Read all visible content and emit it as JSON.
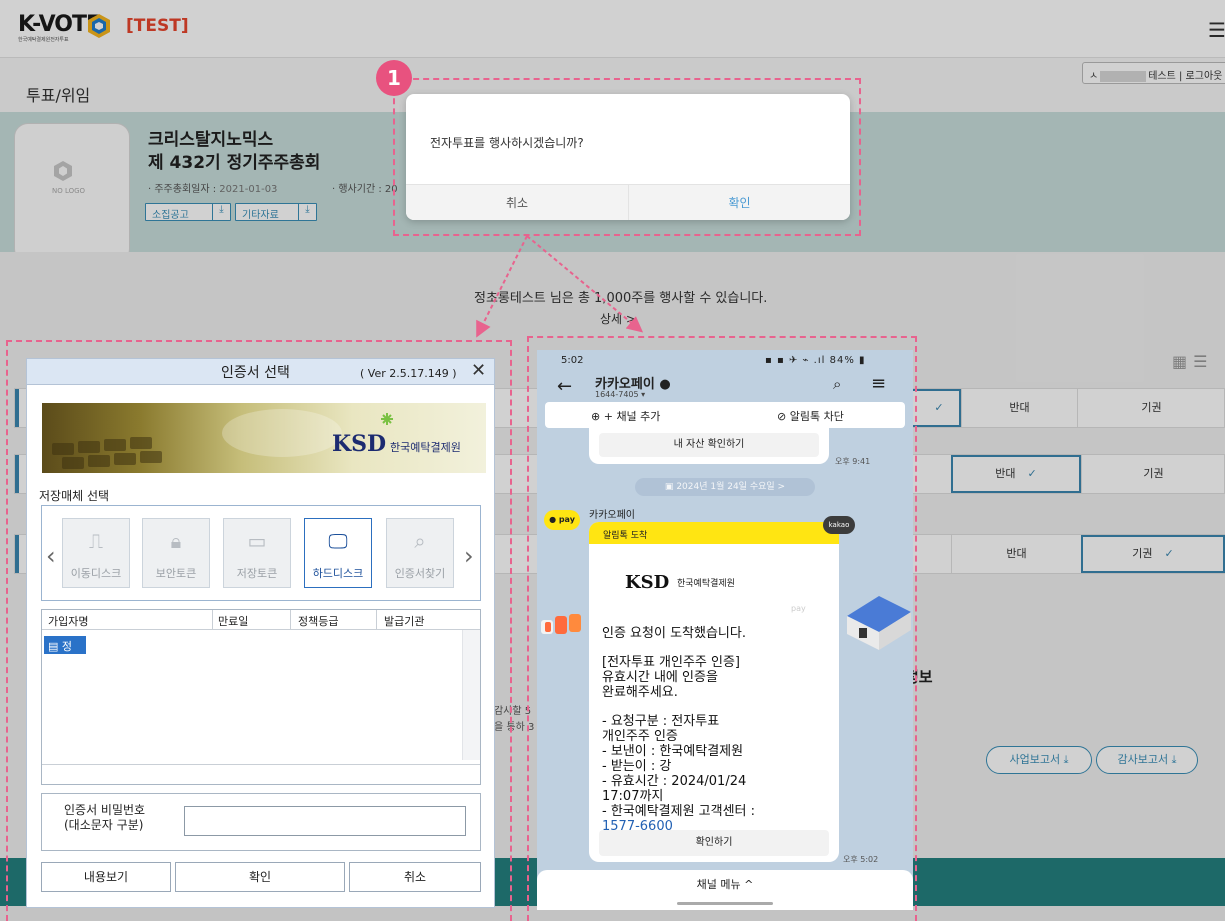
{
  "app": {
    "logo": "K-VOTE",
    "logo_sub": "한국예탁결제원전자투표",
    "test_tag": "[TEST]",
    "page_title": "투표/위임",
    "user_suffix": "테스트",
    "logout": "로그아웃"
  },
  "meeting": {
    "nologo": "NO LOGO",
    "company": "크리스탈지노믹스",
    "name": "제 432기 정기주주총회",
    "date_label": "· 주주총회일자 :",
    "date_value": "2021-01-03",
    "period_label": "· 행사기간 : 20",
    "notice_btn": "소집공고",
    "etc_btn": "기타자료"
  },
  "body": {
    "shares_text": "정초롱테스트 님은 총 1,000주를 행사할 수 있습니다.",
    "detail": "상세 >",
    "oppose": "반대",
    "abstain": "기권",
    "check": "✓",
    "info_heading": "정보",
    "frag1": "감사할 5",
    "frag2": "을 통하 3",
    "biz_report": "사업보고서 ⤓",
    "audit_report": "감사보고서 ⤓"
  },
  "confirm_dialog": {
    "step": "1",
    "message": "전자투표를 행사하시겠습니까?",
    "cancel": "취소",
    "ok": "확인"
  },
  "cert_dialog": {
    "title": "인증서 선택",
    "version": "( Ver 2.5.17.149 )",
    "close": "✕",
    "ksd": "KSD",
    "ksd_kr": "한국예탁결제원",
    "storage_label": "저장매체 선택",
    "media": [
      "이동디스크",
      "보안토큰",
      "저장토큰",
      "하드디스크",
      "인증서찾기"
    ],
    "columns": [
      "가입자명",
      "만료일",
      "정책등급",
      "발급기관"
    ],
    "row_name": "정",
    "pw_label_1": "인증서 비밀번호",
    "pw_label_2": "(대소문자 구분)",
    "view_btn": "내용보기",
    "ok_btn": "확인",
    "cancel_btn": "취소"
  },
  "phone": {
    "time": "5:02",
    "battery": "84%",
    "chat_name": "카카오페이",
    "chat_phone": "1644-7405 ▾",
    "add_channel": "채널 추가",
    "block_alert": "알림톡 차단",
    "prev_button": "내 자산 확인하기",
    "prev_time": "오후 9:41",
    "date_pill": "2024년 1월 24일 수요일 >",
    "sender": "카카오페이",
    "pay_badge": "pay",
    "kakao_badge": "kakao",
    "msg_header": "알림톡 도착",
    "msg_ksd": "KSD",
    "msg_ksd_kr": "한국예탁결제원",
    "msg_pay": "pay",
    "line1": "인증 요청이 도착했습니다.",
    "line2": "[전자투표 개인주주 인증]",
    "line3": "유효시간 내에 인증을",
    "line4": "완료해주세요.",
    "line5": "- 요청구분 : 전자투표",
    "line6": "개인주주 인증",
    "line7": "- 보낸이 : 한국예탁결제원",
    "line8": "- 받는이 : 강",
    "line9": "- 유효시간 : 2024/01/24",
    "line10": "17:07까지",
    "line11": "- 한국예탁결제원 고객센터 :",
    "line12": "1577-6600",
    "confirm_btn": "확인하기",
    "msg_time": "오후 5:02",
    "channel_menu": "채널 메뉴 ^"
  },
  "colors": {
    "accent": "#3b87b0",
    "highlight_dash": "#e8638e",
    "teal_band": "#24817f",
    "kakao_yellow": "#ffe512"
  }
}
